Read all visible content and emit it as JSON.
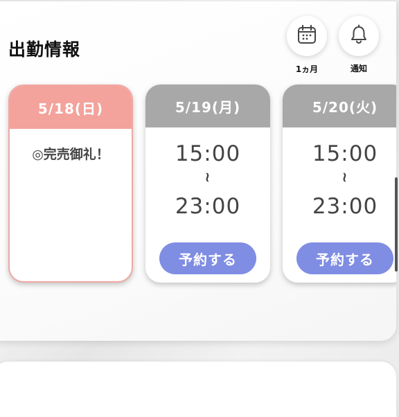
{
  "section": {
    "title": "出勤情報"
  },
  "actions": {
    "month_label": "1ヵ月",
    "notify_label": "通知"
  },
  "days": [
    {
      "date": "5/18(日)",
      "note": "◎完売御礼！",
      "header_color": "#f4a29c",
      "today": true
    },
    {
      "date": "5/19(月)",
      "start": "15:00",
      "separator": "~",
      "end": "23:00",
      "button_label": "予約する",
      "header_color": "#a8a8a8"
    },
    {
      "date": "5/20(火)",
      "start": "15:00",
      "separator": "~",
      "end": "23:00",
      "button_label": "予約する",
      "header_color": "#a8a8a8"
    }
  ],
  "colors": {
    "accent": "#7f8de3",
    "today": "#f4a29c",
    "inactive_header": "#a8a8a8"
  },
  "icons": {
    "month": "calendar-icon",
    "notify": "bell-icon"
  }
}
